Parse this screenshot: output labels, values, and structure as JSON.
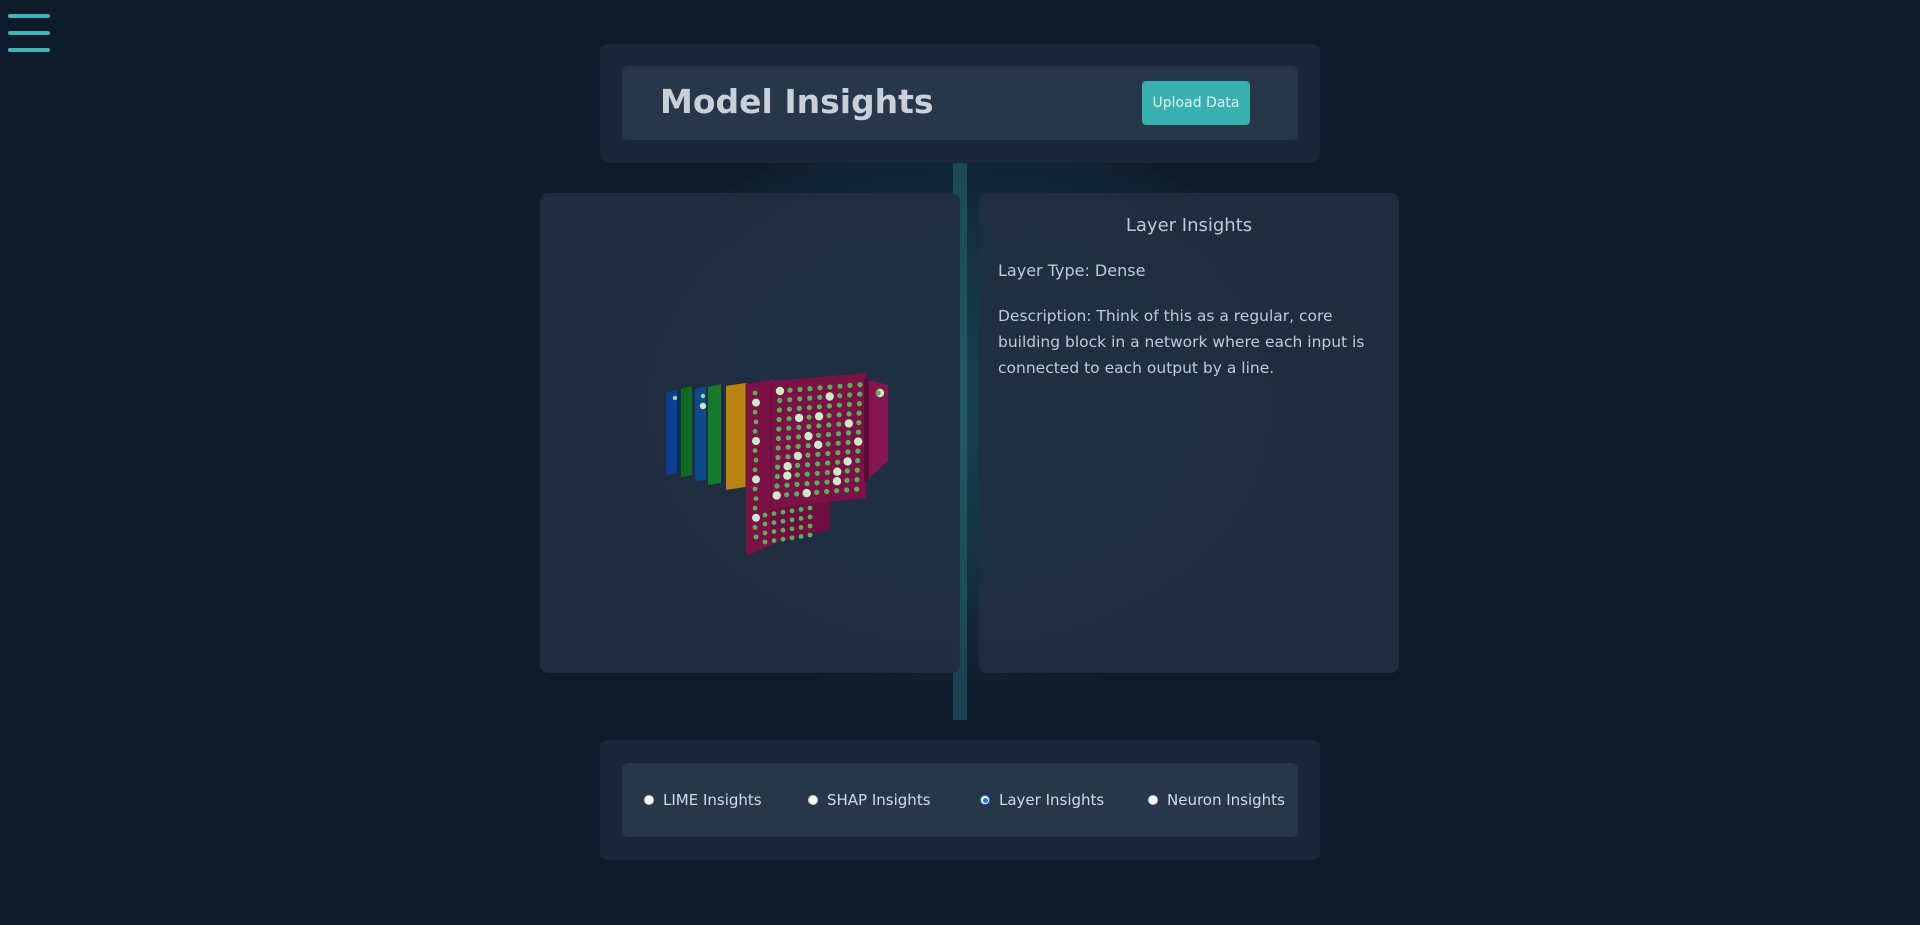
{
  "header": {
    "title": "Model Insights",
    "upload_label": "Upload Data"
  },
  "insights": {
    "title": "Layer Insights",
    "layer_type": "Layer Type: Dense",
    "description": "Description: Think of this as a regular, core building block in a network where each input is connected to each output by a line."
  },
  "options": [
    {
      "label": "LIME Insights",
      "checked": false
    },
    {
      "label": "SHAP Insights",
      "checked": false
    },
    {
      "label": "Layer Insights",
      "checked": true
    },
    {
      "label": "Neuron Insights",
      "checked": false
    }
  ],
  "colors": {
    "accent": "#3aafaf",
    "background": "#0f1b2b",
    "layer_blue": "#0b3f8f",
    "layer_green": "#0f6b26",
    "layer_orange": "#b88313",
    "layer_magenta": "#7a1246",
    "neuron": "#5fae5f"
  }
}
